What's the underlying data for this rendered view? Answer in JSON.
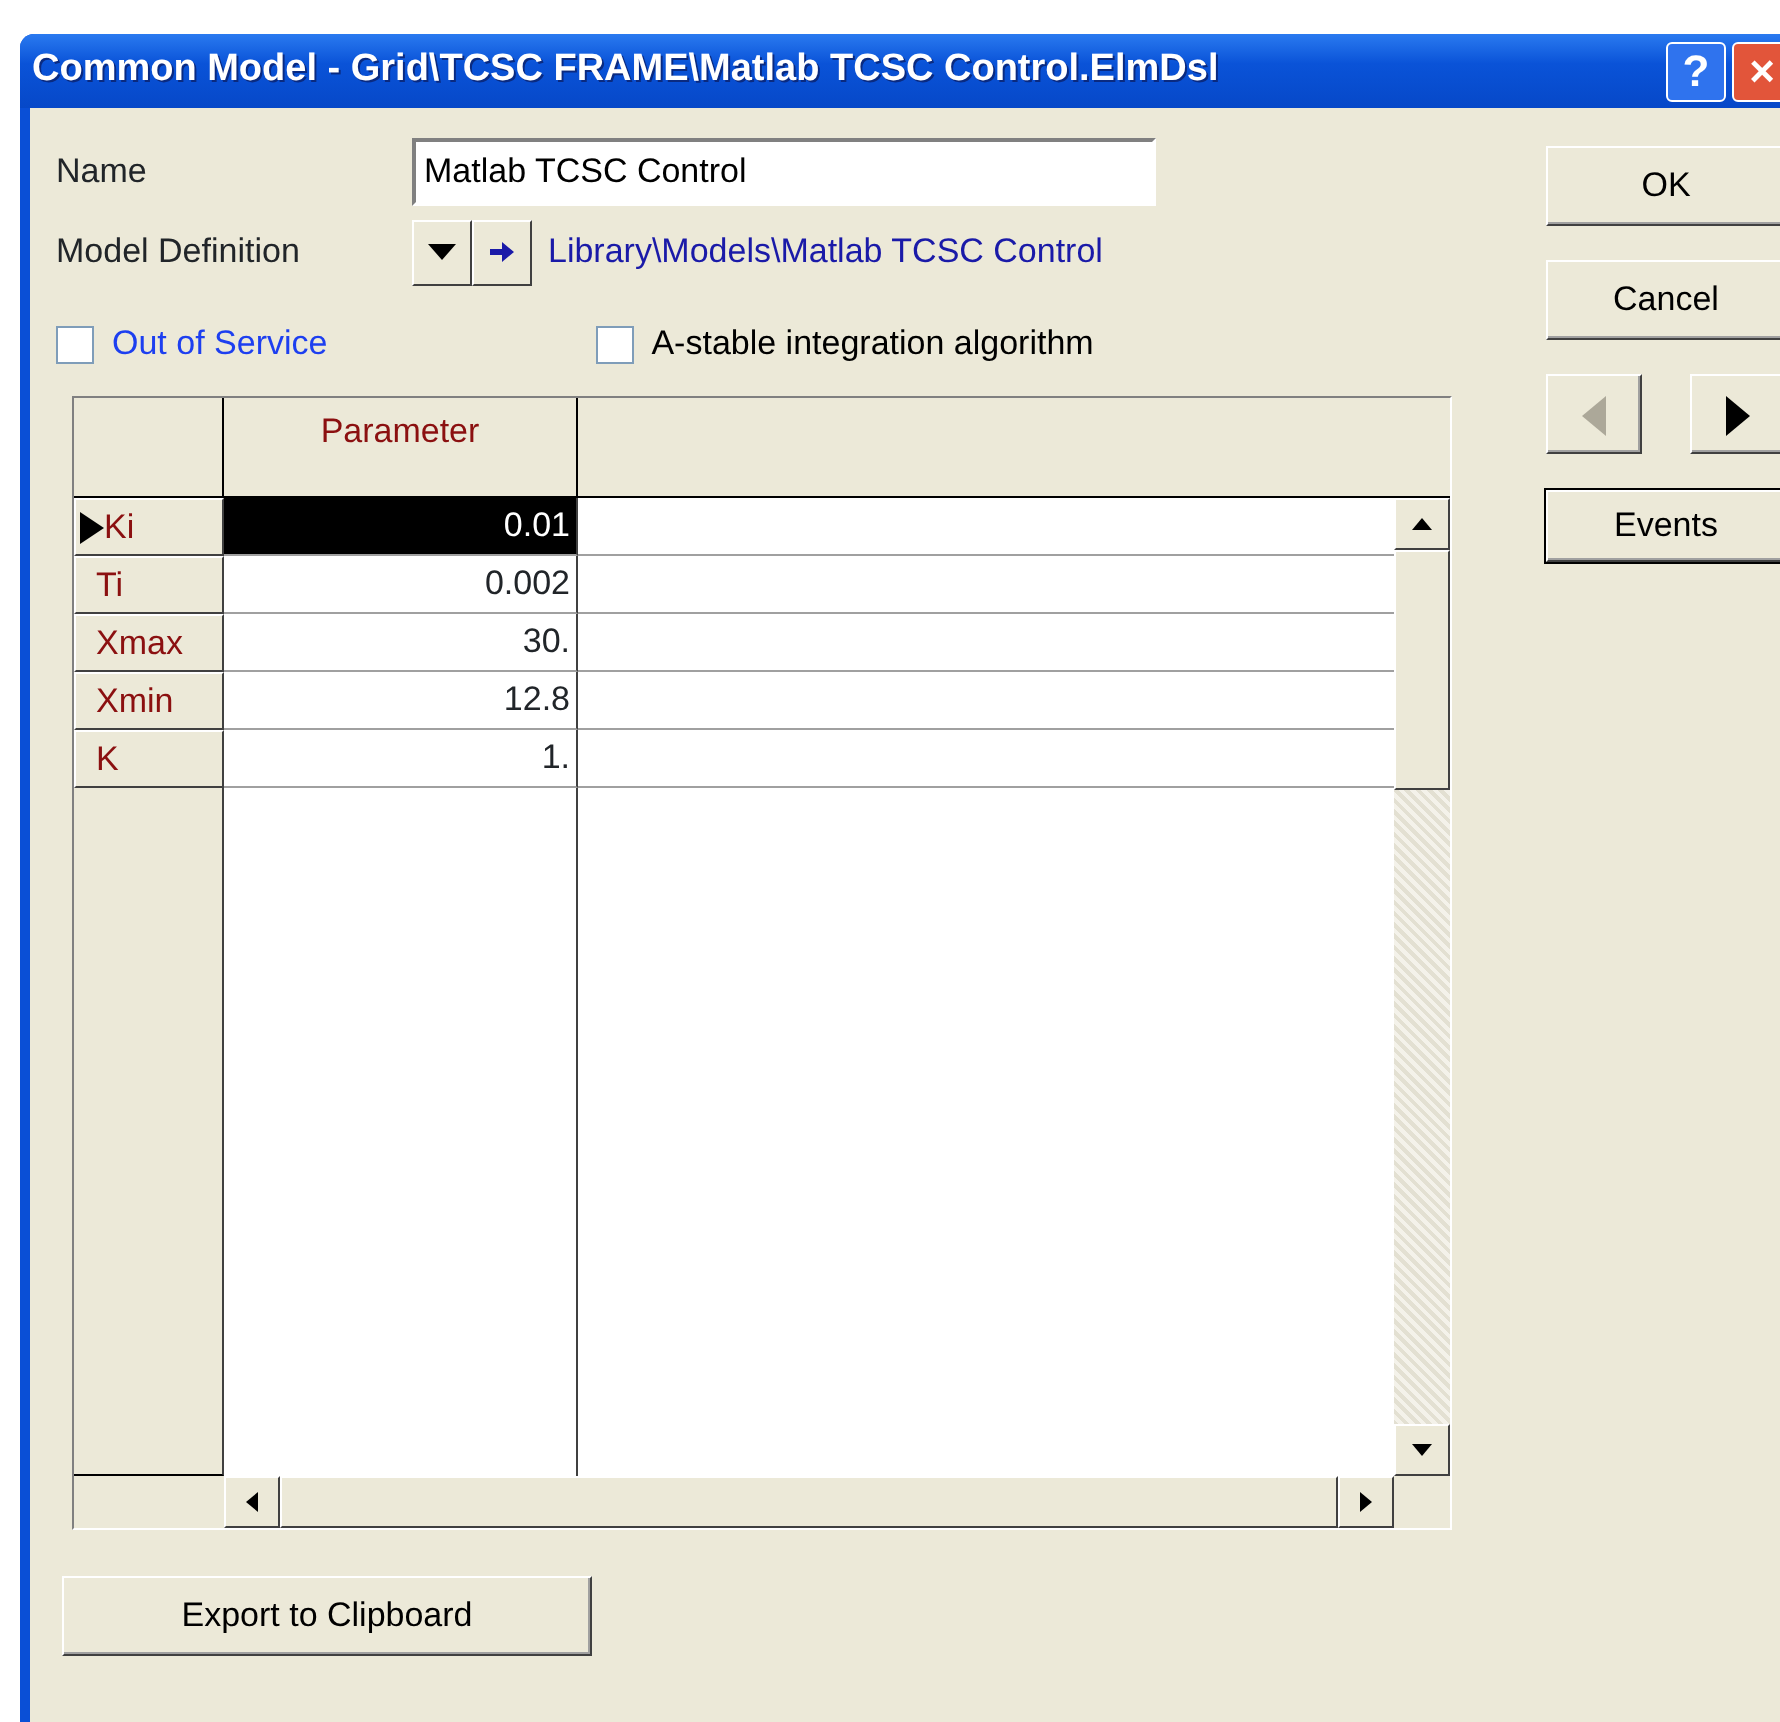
{
  "window": {
    "title": "Common Model - Grid\\TCSC FRAME\\Matlab TCSC Control.ElmDsl",
    "help_button": "?",
    "close_button": "×"
  },
  "name_field": {
    "label": "Name",
    "value": "Matlab TCSC Control"
  },
  "model_definition": {
    "label": "Model Definition",
    "path": "Library\\Models\\Matlab TCSC Control"
  },
  "checkboxes": [
    {
      "label": "Out of Service",
      "checked": false,
      "kind": "link"
    },
    {
      "label": "A-stable integration algorithm",
      "checked": false,
      "kind": "plain"
    }
  ],
  "table": {
    "columns": [
      "Parameter"
    ],
    "rows": [
      {
        "name": "Ki",
        "value": "0.01",
        "selected": true
      },
      {
        "name": "Ti",
        "value": "0.002",
        "selected": false
      },
      {
        "name": "Xmax",
        "value": "30.",
        "selected": false
      },
      {
        "name": "Xmin",
        "value": "12.8",
        "selected": false
      },
      {
        "name": "K",
        "value": "1.",
        "selected": false
      }
    ]
  },
  "buttons": [
    {
      "label": "OK",
      "default": false
    },
    {
      "label": "Cancel",
      "default": false
    }
  ],
  "nav_buttons": [
    {
      "kind": "previous",
      "disabled": true
    },
    {
      "kind": "next",
      "disabled": false
    }
  ],
  "events_button": {
    "label": "Events",
    "default": true
  },
  "export_button": {
    "label": "Export to Clipboard"
  }
}
